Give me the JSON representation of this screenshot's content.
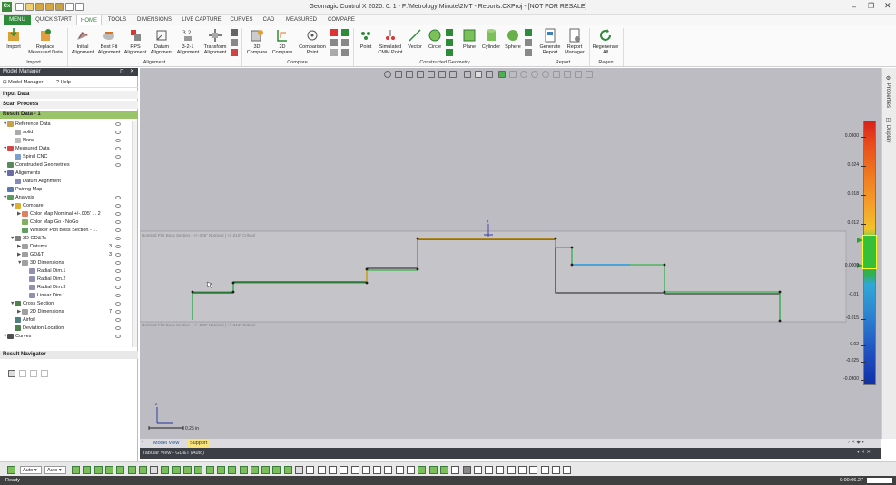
{
  "app": {
    "title": "Geomagic Control X 2020. 0. 1 - F:\\Metrology Minute\\2MT - Reports.CXProj - [NOT FOR RESALE]",
    "logo": "Cx"
  },
  "menu": {
    "tabs": [
      "MENU",
      "QUICK START",
      "HOME",
      "TOOLS",
      "DIMENSIONS",
      "LIVE CAPTURE",
      "CURVES",
      "CAD",
      "MEASURED",
      "COMPARE"
    ]
  },
  "ribbon": {
    "buttons": {
      "import": "Import",
      "replace": "Replace\nMeasured Data",
      "initial": "Initial\nAlignment",
      "bestfit": "Best Fit\nAlignment",
      "rps": "RPS\nAlignment",
      "datum": "Datum\nAlignment",
      "three21": "3-2-1\nAlignment",
      "transform": "Transform\nAlignment",
      "c3d": "3D\nCompare",
      "c2d": "2D\nCompare",
      "comparison": "Comparison\nPoint",
      "point": "Point",
      "simcmm": "Simulated\nCMM Point",
      "vector": "Vector",
      "circle": "Circle",
      "plane": "Plane",
      "cylinder": "Cylinder",
      "sphere": "Sphere",
      "genreport": "Generate\nReport",
      "repmanager": "Report\nManager",
      "regen": "Regenerate\nAll"
    },
    "groups": {
      "import": "Import",
      "alignment": "Alignment",
      "compare": "Compare",
      "constructed": "Constructed Geometry",
      "report": "Report",
      "regen": "Regen"
    }
  },
  "left": {
    "panel_title": "Model Manager",
    "tab_model": "Model Manager",
    "tab_help": "Help",
    "input_data": "Input Data",
    "scan_process": "Scan Process",
    "result_data": "Result Data - 1",
    "tree": [
      {
        "label": "Reference Data",
        "level": 0,
        "arrow": "▼",
        "color": "#c8a050",
        "eye": true
      },
      {
        "label": "solid",
        "level": 1,
        "arrow": "",
        "color": "#aaaaaa",
        "eye": true
      },
      {
        "label": "None",
        "level": 1,
        "arrow": "",
        "color": "#bbbbbb",
        "eye": true
      },
      {
        "label": "Measured Data",
        "level": 0,
        "arrow": "▼",
        "color": "#d04848",
        "eye": true
      },
      {
        "label": "Spiral CNC",
        "level": 1,
        "arrow": "",
        "color": "#7aa0d0",
        "eye": true
      },
      {
        "label": "Constructed Geometries",
        "level": 0,
        "arrow": "",
        "color": "#5a8a5a",
        "eye": true
      },
      {
        "label": "Alignments",
        "level": 0,
        "arrow": "▼",
        "color": "#6a6aa8",
        "eye": false
      },
      {
        "label": "Datum Alignment",
        "level": 1,
        "arrow": "",
        "color": "#8888bb",
        "eye": false
      },
      {
        "label": "Pairing Map",
        "level": 0,
        "arrow": "",
        "color": "#5a7ab0",
        "eye": false
      },
      {
        "label": "Analysis",
        "level": 0,
        "arrow": "▼",
        "color": "#5a9a5a",
        "eye": true
      },
      {
        "label": "Compare",
        "level": 1,
        "arrow": "▼",
        "color": "#e0b030",
        "eye": true
      },
      {
        "label": "Color Map Nominal +/-.005' ... 2",
        "level": 2,
        "arrow": "▶",
        "color": "#e08060",
        "eye": true
      },
      {
        "label": "Color Map Go - NoGo",
        "level": 2,
        "arrow": "",
        "color": "#80b060",
        "eye": true
      },
      {
        "label": "Whisker Plot Boss Section - ...",
        "level": 2,
        "arrow": "",
        "color": "#60a060",
        "eye": true
      },
      {
        "label": "3D GD&Ts",
        "level": 1,
        "arrow": "▼",
        "color": "#808080",
        "eye": true
      },
      {
        "label": "Datums",
        "level": 2,
        "arrow": "▶",
        "color": "#a0a0a0",
        "eye": true,
        "count": "3"
      },
      {
        "label": "GD&T",
        "level": 2,
        "arrow": "▶",
        "color": "#a0a0a0",
        "eye": true,
        "count": "3"
      },
      {
        "label": "3D Dimensions",
        "level": 2,
        "arrow": "▼",
        "color": "#a0a0a0",
        "eye": true
      },
      {
        "label": "Radial Dim.1",
        "level": 3,
        "arrow": "",
        "color": "#9090b0",
        "eye": true
      },
      {
        "label": "Radial Dim.2",
        "level": 3,
        "arrow": "",
        "color": "#9090b0",
        "eye": true
      },
      {
        "label": "Radial Dim.3",
        "level": 3,
        "arrow": "",
        "color": "#9090b0",
        "eye": true
      },
      {
        "label": "Linear Dim.1",
        "level": 3,
        "arrow": "",
        "color": "#9090b0",
        "eye": true
      },
      {
        "label": "Cross Section",
        "level": 1,
        "arrow": "▼",
        "color": "#508050",
        "eye": true
      },
      {
        "label": "2D Dimensions",
        "level": 2,
        "arrow": "▶",
        "color": "#a0a0a0",
        "eye": true,
        "count": "7"
      },
      {
        "label": "Airfoil",
        "level": 1,
        "arrow": "",
        "color": "#508080",
        "eye": true
      },
      {
        "label": "Deviation Location",
        "level": 1,
        "arrow": "",
        "color": "#508050",
        "eye": true
      },
      {
        "label": "Curves",
        "level": 0,
        "arrow": "▼",
        "color": "#505050",
        "eye": true
      }
    ],
    "result_navigator": "Result Navigator"
  },
  "viewport": {
    "section_label_top": "Nominal Plot Boss Section - +/-.005\" Nominal | +/-.010\" Critical",
    "section_label_bottom": "Nominal Plot Boss Section - +/-.005\" Nominal | +/-.010\" Critical",
    "scale_label": "0.25 in",
    "axis_z": "z",
    "colorbar": {
      "ticks": [
        {
          "value": "0.0300",
          "pos": 0.06
        },
        {
          "value": "0.024",
          "pos": 0.17
        },
        {
          "value": "0.018",
          "pos": 0.28
        },
        {
          "value": "0.012",
          "pos": 0.39
        },
        {
          "value": "0.0000",
          "pos": 0.55
        },
        {
          "value": "-0.01",
          "pos": 0.66
        },
        {
          "value": "-0.015",
          "pos": 0.75
        },
        {
          "value": "-0.02",
          "pos": 0.85
        },
        {
          "value": "-0.025",
          "pos": 0.91
        },
        {
          "value": "-0.0300",
          "pos": 0.98
        }
      ]
    }
  },
  "sidetabs": {
    "properties": "Properties",
    "display": "Display"
  },
  "view_tabs": {
    "model": "Model View",
    "support": "Support"
  },
  "tabular": {
    "title": "Tabular View - GD&T (Auto)"
  },
  "bottom": {
    "auto1": "Auto",
    "auto2": "Auto"
  },
  "status": {
    "text": "Ready",
    "time": "0:00:06.27"
  }
}
